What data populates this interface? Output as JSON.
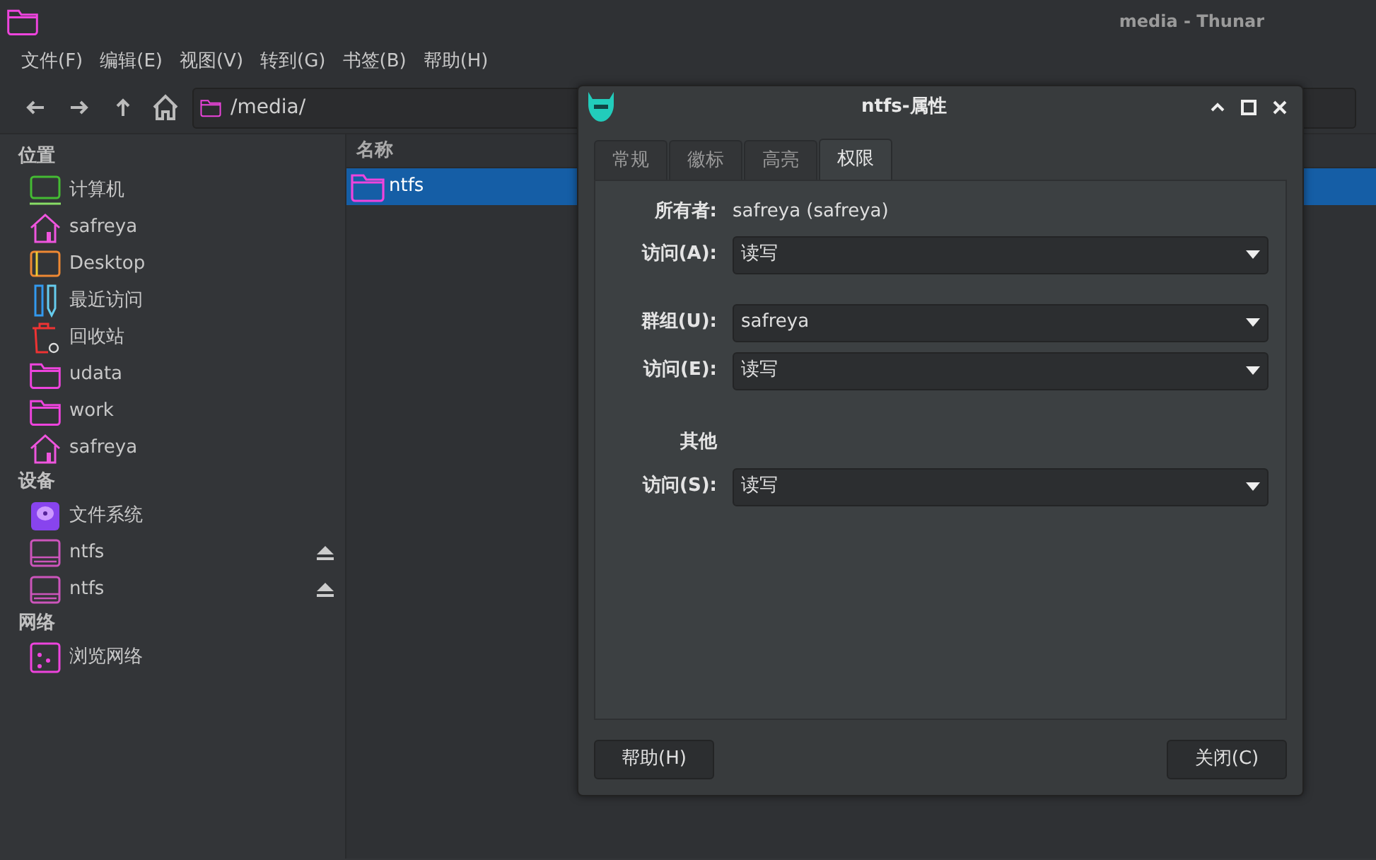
{
  "window": {
    "title": "media - Thunar"
  },
  "menu": [
    "文件(F)",
    "编辑(E)",
    "视图(V)",
    "转到(G)",
    "书签(B)",
    "帮助(H)"
  ],
  "location": {
    "path": "/media/"
  },
  "sidebar": [
    {
      "title": "位置",
      "items": [
        {
          "label": "计算机",
          "kind": "computer",
          "ejectable": false
        },
        {
          "label": "safreya",
          "kind": "home",
          "ejectable": false
        },
        {
          "label": "Desktop",
          "kind": "desktop",
          "ejectable": false
        },
        {
          "label": "最近访问",
          "kind": "recent",
          "ejectable": false
        },
        {
          "label": "回收站",
          "kind": "trash",
          "ejectable": false
        },
        {
          "label": "udata",
          "kind": "folder",
          "ejectable": false
        },
        {
          "label": "work",
          "kind": "folder",
          "ejectable": false
        },
        {
          "label": "safreya",
          "kind": "home",
          "ejectable": false
        }
      ]
    },
    {
      "title": "设备",
      "items": [
        {
          "label": "文件系统",
          "kind": "disk",
          "ejectable": false
        },
        {
          "label": "ntfs",
          "kind": "drive",
          "ejectable": true
        },
        {
          "label": "ntfs",
          "kind": "drive",
          "ejectable": true
        }
      ]
    },
    {
      "title": "网络",
      "items": [
        {
          "label": "浏览网络",
          "kind": "network",
          "ejectable": false
        }
      ]
    }
  ],
  "file_list": {
    "column": "名称",
    "rows": [
      {
        "name": "ntfs",
        "selected": true
      }
    ]
  },
  "dialog": {
    "title": "ntfs-属性",
    "tabs": [
      {
        "label": "常规",
        "selected": false
      },
      {
        "label": "徽标",
        "selected": false
      },
      {
        "label": "高亮",
        "selected": false
      },
      {
        "label": "权限",
        "selected": true
      }
    ],
    "groups": [
      [
        {
          "kind": "info",
          "label": "所有者:",
          "value": "safreya (safreya)"
        },
        {
          "kind": "combo",
          "label": "访问(A):",
          "value": "读写"
        }
      ],
      [
        {
          "kind": "combo",
          "label": "群组(U):",
          "value": "safreya"
        },
        {
          "kind": "combo",
          "label": "访问(E):",
          "value": "读写"
        }
      ],
      [
        {
          "kind": "heading",
          "label": "其他"
        },
        {
          "kind": "combo",
          "label": "访问(S):",
          "value": "读写"
        }
      ]
    ],
    "buttons": [
      "帮助(H)",
      "关闭(C)"
    ]
  }
}
